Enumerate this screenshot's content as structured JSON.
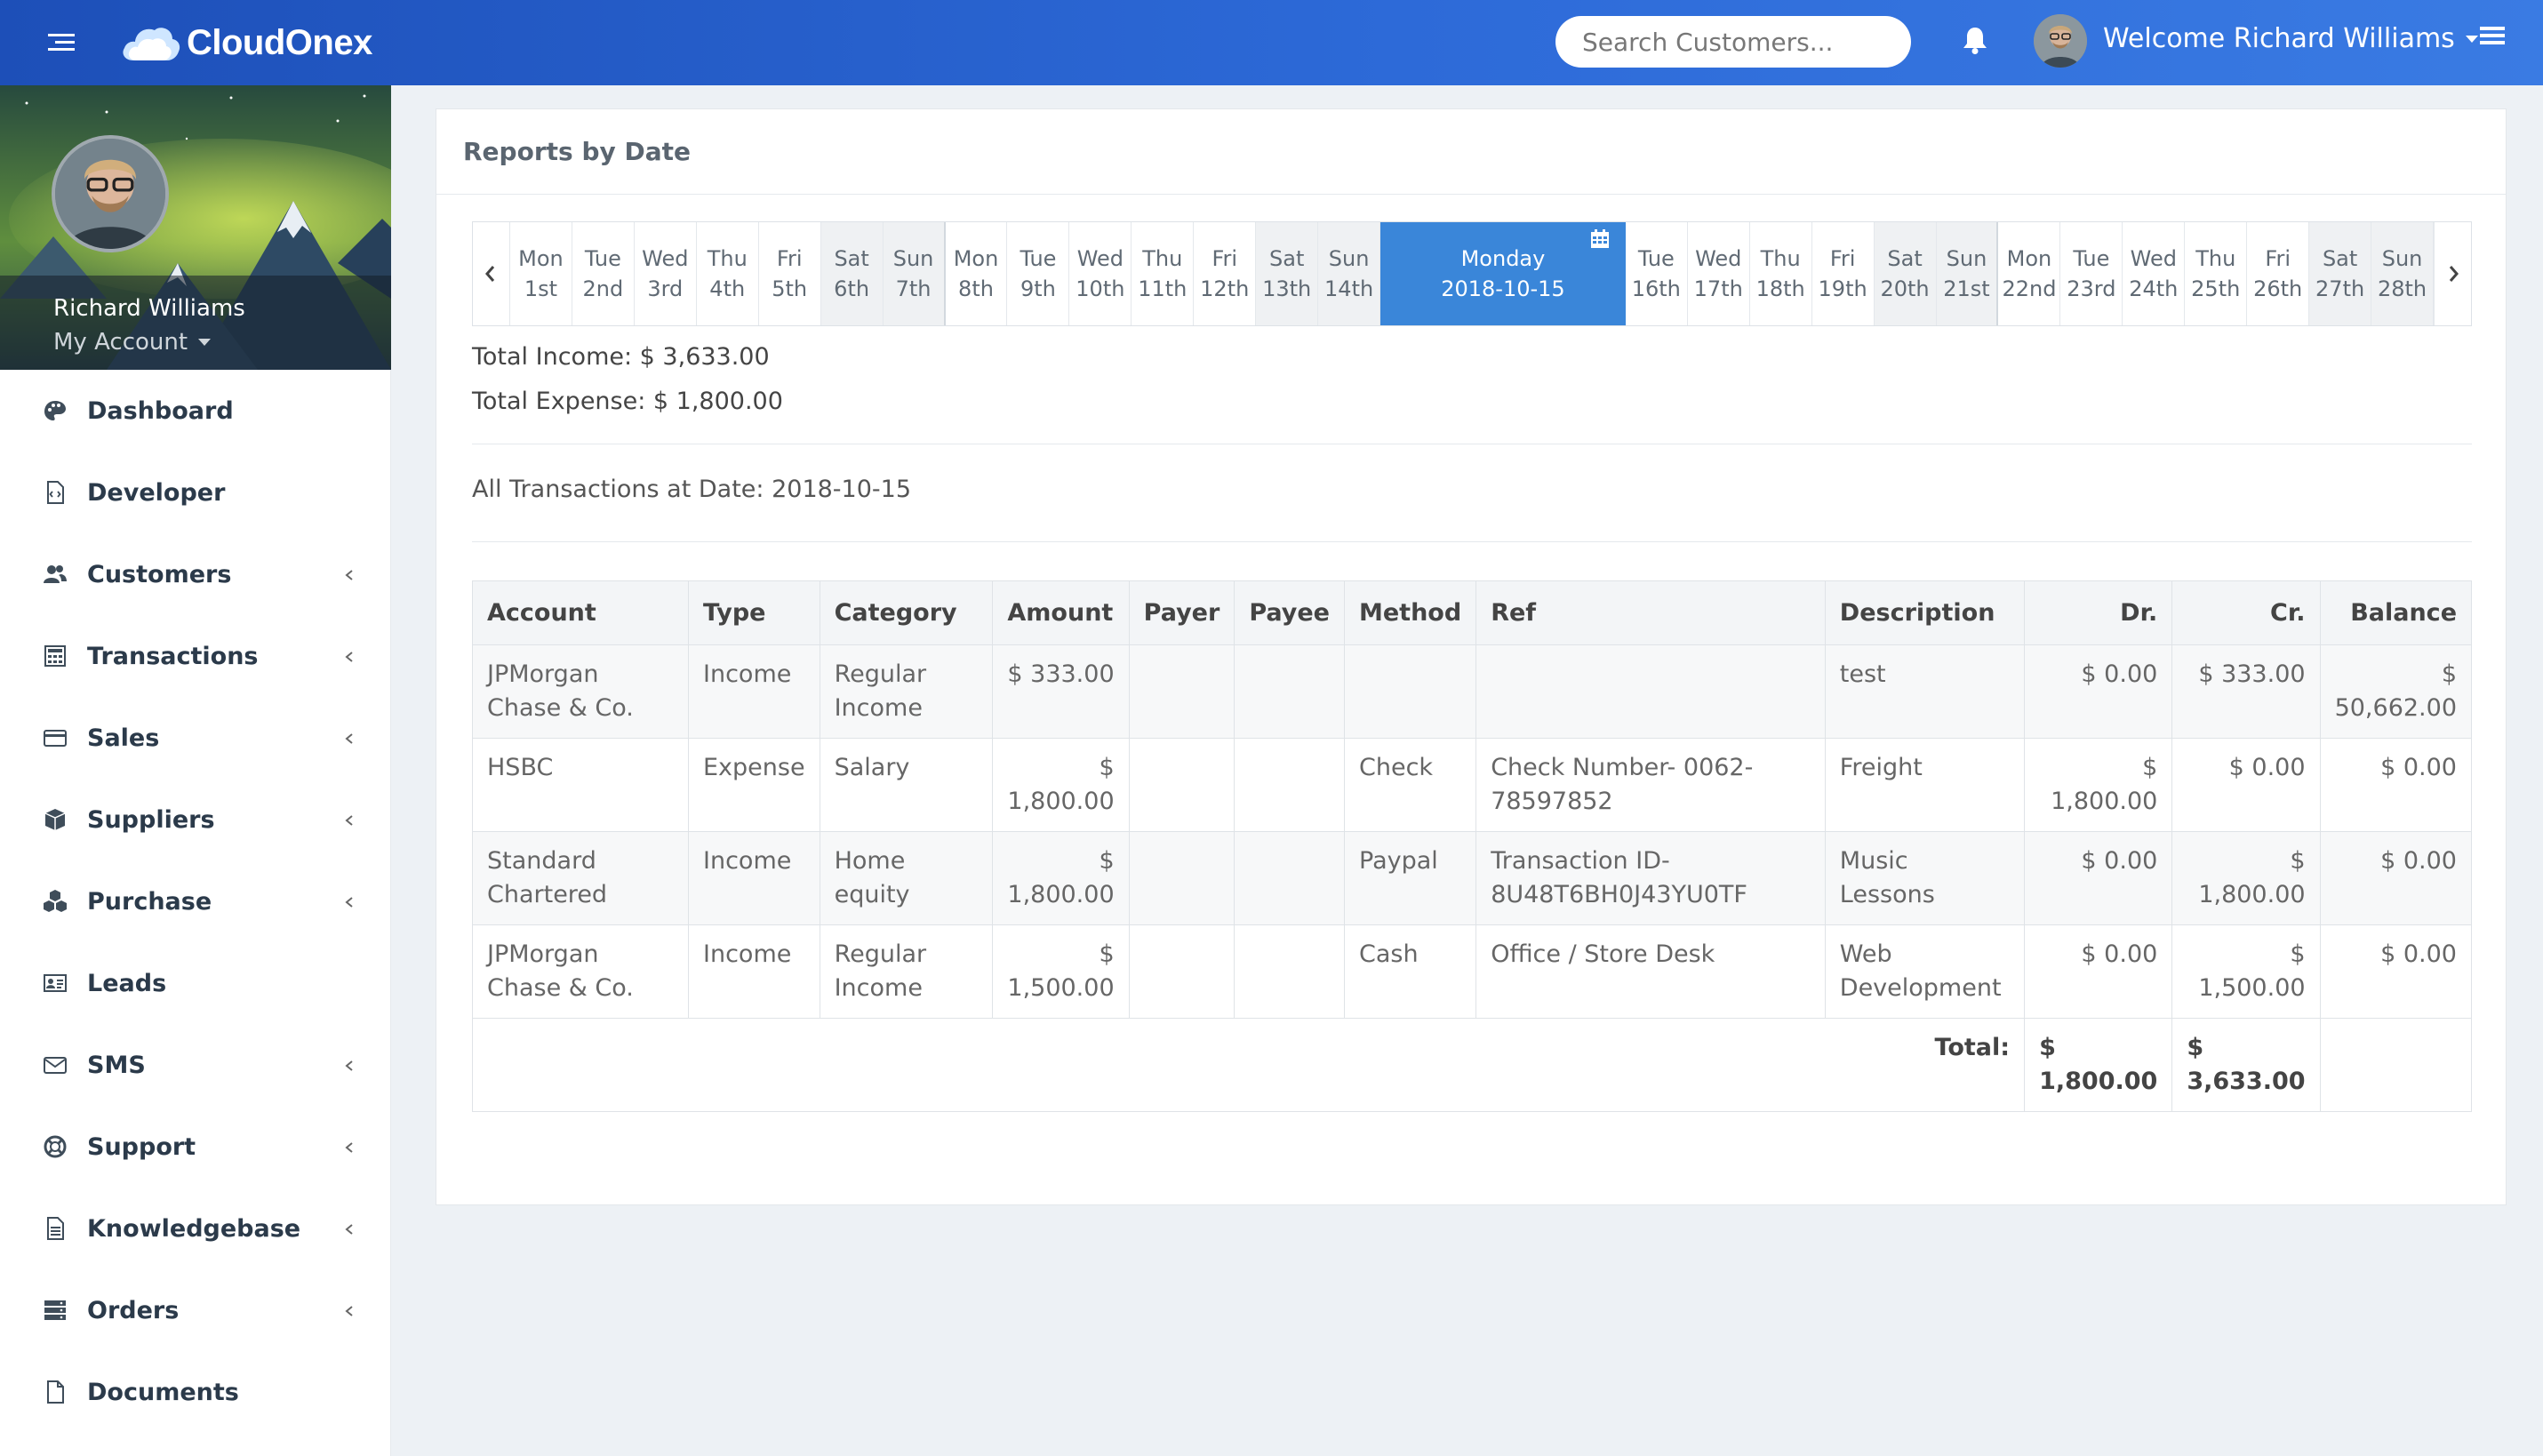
{
  "header": {
    "brand": "CloudOnex",
    "search_placeholder": "Search Customers...",
    "welcome": "Welcome Richard Williams",
    "colors": {
      "bar_start": "#1d4fb8",
      "bar_end": "#3a7be3"
    }
  },
  "sidebar": {
    "profile_name": "Richard Williams",
    "account_label": "My Account",
    "items": [
      {
        "label": "Dashboard",
        "icon": "palette-icon",
        "has_submenu": false
      },
      {
        "label": "Developer",
        "icon": "code-file-icon",
        "has_submenu": false
      },
      {
        "label": "Customers",
        "icon": "users-icon",
        "has_submenu": true
      },
      {
        "label": "Transactions",
        "icon": "calculator-icon",
        "has_submenu": true
      },
      {
        "label": "Sales",
        "icon": "credit-card-icon",
        "has_submenu": true
      },
      {
        "label": "Suppliers",
        "icon": "cube-icon",
        "has_submenu": true
      },
      {
        "label": "Purchase",
        "icon": "cubes-icon",
        "has_submenu": true
      },
      {
        "label": "Leads",
        "icon": "id-card-icon",
        "has_submenu": false
      },
      {
        "label": "SMS",
        "icon": "envelope-icon",
        "has_submenu": true
      },
      {
        "label": "Support",
        "icon": "life-ring-icon",
        "has_submenu": true
      },
      {
        "label": "Knowledgebase",
        "icon": "document-icon",
        "has_submenu": true
      },
      {
        "label": "Orders",
        "icon": "server-icon",
        "has_submenu": true
      },
      {
        "label": "Documents",
        "icon": "file-icon",
        "has_submenu": false
      }
    ]
  },
  "main": {
    "title": "Reports by Date",
    "days_before": [
      {
        "day": "Mon",
        "date": "1st"
      },
      {
        "day": "Tue",
        "date": "2nd"
      },
      {
        "day": "Wed",
        "date": "3rd"
      },
      {
        "day": "Thu",
        "date": "4th"
      },
      {
        "day": "Fri",
        "date": "5th"
      },
      {
        "day": "Sat",
        "date": "6th"
      },
      {
        "day": "Sun",
        "date": "7th"
      },
      {
        "day": "Mon",
        "date": "8th"
      },
      {
        "day": "Tue",
        "date": "9th"
      },
      {
        "day": "Wed",
        "date": "10th"
      },
      {
        "day": "Thu",
        "date": "11th"
      },
      {
        "day": "Fri",
        "date": "12th"
      },
      {
        "day": "Sat",
        "date": "13th"
      },
      {
        "day": "Sun",
        "date": "14th"
      }
    ],
    "selected_day": {
      "day": "Monday",
      "date": "2018-10-15"
    },
    "days_after": [
      {
        "day": "Tue",
        "date": "16th"
      },
      {
        "day": "Wed",
        "date": "17th"
      },
      {
        "day": "Thu",
        "date": "18th"
      },
      {
        "day": "Fri",
        "date": "19th"
      },
      {
        "day": "Sat",
        "date": "20th"
      },
      {
        "day": "Sun",
        "date": "21st"
      },
      {
        "day": "Mon",
        "date": "22nd"
      },
      {
        "day": "Tue",
        "date": "23rd"
      },
      {
        "day": "Wed",
        "date": "24th"
      },
      {
        "day": "Thu",
        "date": "25th"
      },
      {
        "day": "Fri",
        "date": "26th"
      },
      {
        "day": "Sat",
        "date": "27th"
      },
      {
        "day": "Sun",
        "date": "28th"
      }
    ],
    "total_income": "Total Income: $ 3,633.00",
    "total_expense": "Total Expense: $ 1,800.00",
    "transactions_heading": "All Transactions at Date: 2018-10-15",
    "table": {
      "columns": [
        "Account",
        "Type",
        "Category",
        "Amount",
        "Payer",
        "Payee",
        "Method",
        "Ref",
        "Description",
        "Dr.",
        "Cr.",
        "Balance"
      ],
      "rows": [
        [
          "JPMorgan Chase & Co.",
          "Income",
          "Regular Income",
          "$ 333.00",
          "",
          "",
          "",
          "",
          "test",
          "$ 0.00",
          "$ 333.00",
          "$ 50,662.00"
        ],
        [
          "HSBC",
          "Expense",
          "Salary",
          "$ 1,800.00",
          "",
          "",
          "Check",
          "Check Number- 0062-78597852",
          "Freight",
          "$ 1,800.00",
          "$ 0.00",
          "$ 0.00"
        ],
        [
          "Standard Chartered",
          "Income",
          "Home equity",
          "$ 1,800.00",
          "",
          "",
          "Paypal",
          "Transaction ID-8U48T6BH0J43YU0TF",
          "Music Lessons",
          "$ 0.00",
          "$ 1,800.00",
          "$ 0.00"
        ],
        [
          "JPMorgan Chase & Co.",
          "Income",
          "Regular Income",
          "$ 1,500.00",
          "",
          "",
          "Cash",
          "Office / Store Desk",
          "Web Development",
          "$ 0.00",
          "$ 1,500.00",
          "$ 0.00"
        ]
      ],
      "total_label": "Total:",
      "total_dr": "$ 1,800.00",
      "total_cr": "$ 3,633.00"
    },
    "colors": {
      "selected_day": "#3a86d9",
      "weekend": "#eff1f3"
    }
  }
}
